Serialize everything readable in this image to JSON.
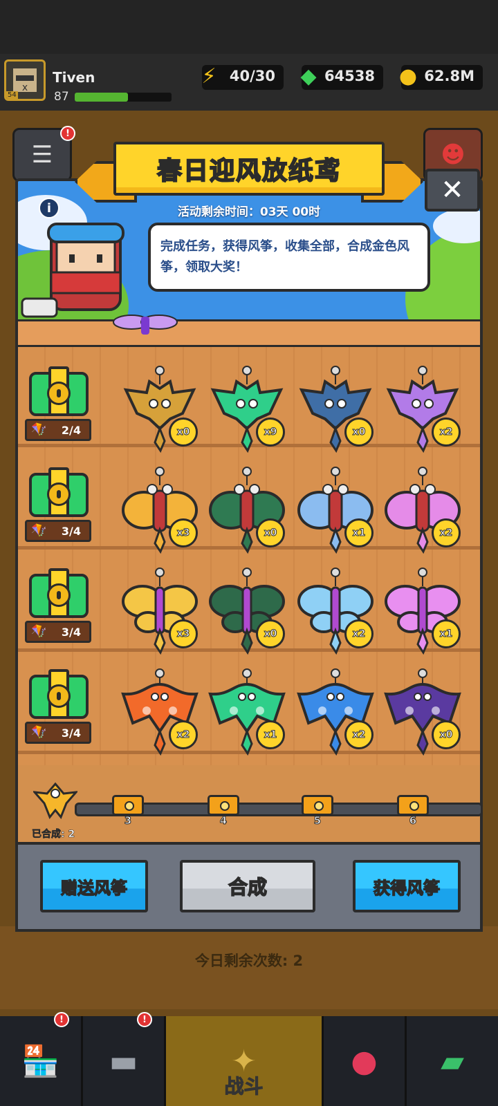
{
  "hud": {
    "player_name": "Tiven",
    "player_level": "87",
    "avatar_level": "54",
    "xp_fraction": 0.55,
    "energy": "40/30",
    "gems": "64538",
    "coins": "62.8M",
    "icons": {
      "energy": "lightning-plus-icon",
      "gems": "green-gem-plus-icon",
      "coins": "gold-coin-plus-icon"
    }
  },
  "modal": {
    "title": "春日迎风放纸鸢",
    "timer": "活动剩余时间：03天 00时",
    "description": "完成任务，获得风筝，收集全部，合成金色风筝，领取大奖！",
    "info_icon": "i",
    "close_icon": "✕"
  },
  "rows": [
    {
      "progress": "2/4",
      "kites": [
        {
          "count": "x0",
          "color": "#d6a13a",
          "shape": "bat"
        },
        {
          "count": "x9",
          "color": "#2fcf8a",
          "shape": "bat"
        },
        {
          "count": "x0",
          "color": "#3f6ea6",
          "shape": "bat"
        },
        {
          "count": "x2",
          "color": "#b27be8",
          "shape": "bat"
        }
      ]
    },
    {
      "progress": "3/4",
      "kites": [
        {
          "count": "x3",
          "color": "#f3b33a",
          "shape": "moth"
        },
        {
          "count": "x0",
          "color": "#2f7a52",
          "shape": "moth"
        },
        {
          "count": "x1",
          "color": "#8bbcf0",
          "shape": "moth"
        },
        {
          "count": "x2",
          "color": "#e58be8",
          "shape": "moth"
        }
      ]
    },
    {
      "progress": "3/4",
      "kites": [
        {
          "count": "x3",
          "color": "#f4c646",
          "shape": "butterfly"
        },
        {
          "count": "x0",
          "color": "#2e6a4a",
          "shape": "butterfly"
        },
        {
          "count": "x2",
          "color": "#8fd0f5",
          "shape": "butterfly"
        },
        {
          "count": "x1",
          "color": "#e88ff0",
          "shape": "butterfly"
        }
      ]
    },
    {
      "progress": "3/4",
      "kites": [
        {
          "count": "x2",
          "color": "#f26a2a",
          "shape": "bird"
        },
        {
          "count": "x1",
          "color": "#2fcf8a",
          "shape": "bird"
        },
        {
          "count": "x2",
          "color": "#3a8be8",
          "shape": "bird"
        },
        {
          "count": "x0",
          "color": "#5a3aa0",
          "shape": "bird"
        }
      ]
    }
  ],
  "synth": {
    "label": "已合成: 2",
    "milestones": [
      "3",
      "4",
      "5",
      "6"
    ]
  },
  "buttons": {
    "gift": "赠送风筝",
    "synthesize": "合成",
    "obtain": "获得风筝"
  },
  "remaining": "今日剩余次数: 2",
  "nav": {
    "active_label": "战斗",
    "items": [
      "shop-icon",
      "weapon-icon",
      "battle-icon",
      "event-ball-icon",
      "scroll-icon"
    ]
  },
  "badges": {
    "exclaim": "!"
  }
}
